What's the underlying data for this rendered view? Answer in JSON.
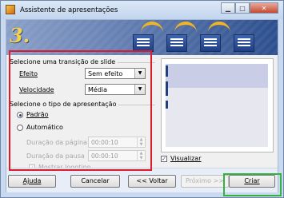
{
  "window": {
    "title": "Assistente de apresentações",
    "controls": [
      "minimize",
      "maximize",
      "close"
    ]
  },
  "banner": {
    "step": "3."
  },
  "transition": {
    "group_label": "Selecione uma transição de slide",
    "effect_label": "Efeito",
    "effect_value": "Sem efeito",
    "speed_label": "Velocidade",
    "speed_value": "Média"
  },
  "presentation": {
    "group_label": "Selecione o tipo de apresentação",
    "option_default": "Padrão",
    "option_auto": "Automático",
    "selected": "Padrão",
    "page_duration_label": "Duração da página",
    "page_duration_value": "00:00:10",
    "pause_duration_label": "Duração da pausa",
    "pause_duration_value": "00:00:10",
    "show_logo_label": "Mostrar logotipo",
    "show_logo_checked": true
  },
  "preview": {
    "label": "Visualizar",
    "checked": true
  },
  "buttons": {
    "help": "Ajuda",
    "cancel": "Cancelar",
    "back": "<< Voltar",
    "next": "Próximo >>",
    "create": "Criar"
  },
  "icons": {
    "check_glyph": "✓",
    "dropdown_glyph": "▼",
    "spin_up_glyph": "▲",
    "spin_down_glyph": "▼",
    "minimize_glyph": "▁",
    "maximize_glyph": "□",
    "close_glyph": "✕"
  },
  "colors": {
    "highlight_red": "#e01a2a",
    "highlight_green": "#35b23e",
    "banner_dark": "#2c4f8e",
    "step_yellow": "#f6d24a"
  }
}
